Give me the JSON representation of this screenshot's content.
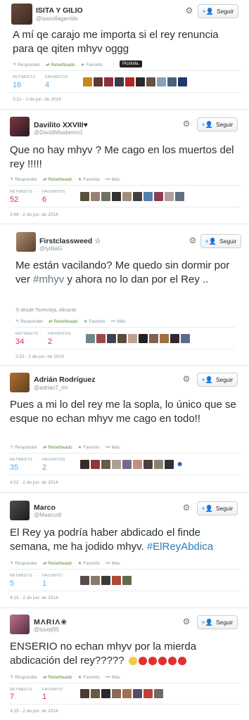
{
  "labels": {
    "reply": "Responder",
    "retweeted": "Retwitteado",
    "favorite": "Favorito",
    "more": "Más",
    "retweets": "RETWEETS",
    "favorites": "FAVORITOS",
    "favorite_singular": "FAVORITO",
    "follow": "Seguir",
    "tooltip": "Picsfolla."
  },
  "colors": {
    "accent": "#55acee",
    "retweet": "#5c913b",
    "muted": "#8899a6"
  },
  "tweets": [
    {
      "name": "ISITA Y GILIO",
      "handle": "@isasollagarrido",
      "text": "A mí qe carajo me importa si el rey renuncia para qe qiten mhyv oggg",
      "retweets": "16",
      "favorites": "4",
      "time": "3:21 - 2 de jun. de 2014"
    },
    {
      "name": "Davilito XXVIII♥",
      "handle": "@DavidMisabemo1",
      "text": "Que no hay mhyv ? Me cago en los muertos del rey !!!!!",
      "retweets": "52",
      "favorites": "6",
      "time": "3:46 - 2 de jun. de 2014"
    },
    {
      "name": "Firstclassweed ☆",
      "handle": "@lydiiaG",
      "text_pre": "Me están vacilando? Me quedo sin dormir por ver ",
      "hashtag": "#mhyv",
      "text_post": " y ahora no lo dan por el Rey ..",
      "location": "desde Torrevieja, Alicante",
      "retweets": "34",
      "favorites": "2",
      "time": "3:53 - 2 de jun. de 2014"
    },
    {
      "name": "Adrián Rodríguez",
      "handle": "@adrian7_rm",
      "text": "Pues a mi lo del rey me la sopla, lo único que se esque no echan mhyv me cago en todo!!",
      "retweets": "35",
      "favorites": "2",
      "time": "4:02 - 2 de jun. de 2014"
    },
    {
      "name": "Marco",
      "handle": "@Maarco9",
      "text_pre": "El Rey ya podría haber abdicado el finde semana, me ha jodido mhyv. ",
      "hashtag": "#ElReyAbdica",
      "retweets": "5",
      "favorites": "1",
      "time": "4:15 - 2 de jun. de 2014"
    },
    {
      "name": "MΛRIΛ❀",
      "handle": "@tuvejt95",
      "text": "ENSERIO no echan mhyv por la mierda abdicación del rey?????",
      "retweets": "7",
      "favorites": "1",
      "time": "4:15 - 2 de jun. de 2014"
    }
  ]
}
